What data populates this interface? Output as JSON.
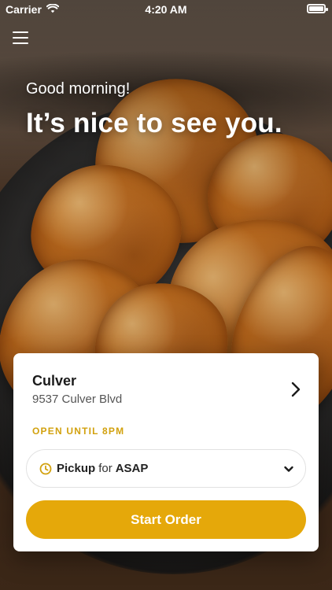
{
  "status_bar": {
    "carrier": "Carrier",
    "time": "4:20 AM",
    "icons": [
      "wifi-icon",
      "battery-icon"
    ]
  },
  "header": {
    "menu_icon": "hamburger-icon"
  },
  "hero": {
    "greeting": "Good morning!",
    "headline": "It’s nice to see you."
  },
  "location_card": {
    "name": "Culver",
    "address": "9537 Culver Blvd",
    "hours": "OPEN UNTIL 8PM",
    "chevron_icon": "chevron-right-icon",
    "pickup": {
      "icon": "clock-icon",
      "mode": "Pickup",
      "for": "for",
      "time": "ASAP",
      "dropdown_icon": "chevron-down-icon"
    },
    "start_button": "Start Order"
  },
  "colors": {
    "accent": "#e5a80a",
    "hours_text": "#d2a10e",
    "card_bg": "#ffffff"
  }
}
